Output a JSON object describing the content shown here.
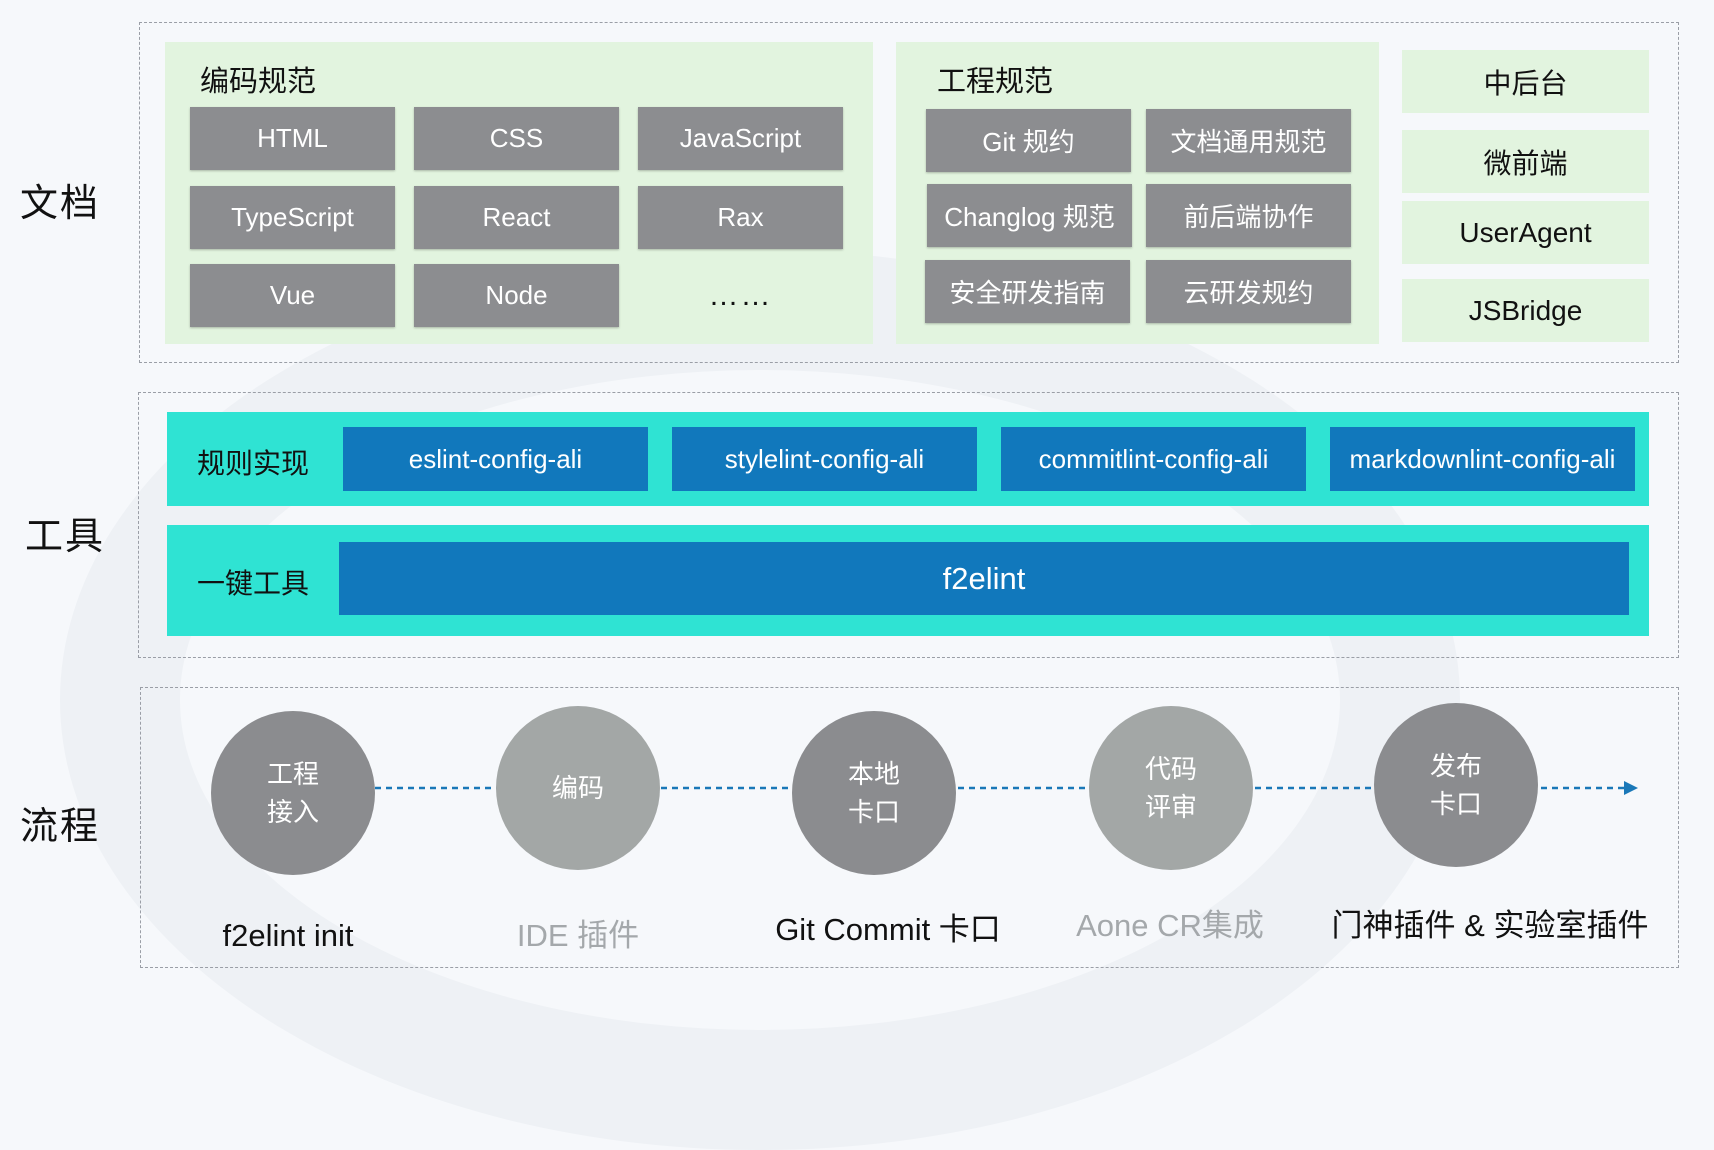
{
  "rows": {
    "docs": "文档",
    "tools": "工具",
    "process": "流程"
  },
  "coding_standards": {
    "title": "编码规范",
    "items": [
      "HTML",
      "CSS",
      "JavaScript",
      "TypeScript",
      "React",
      "Rax",
      "Vue",
      "Node"
    ],
    "more": "……"
  },
  "engineering_standards": {
    "title": "工程规范",
    "items": [
      "Git 规约",
      "文档通用规范",
      "Changlog 规范",
      "前后端协作",
      "安全研发指南",
      "云研发规约"
    ]
  },
  "extra_docs": [
    "中后台",
    "微前端",
    "UserAgent",
    "JSBridge"
  ],
  "tools": {
    "rules_label": "规则实现",
    "rules": [
      "eslint-config-ali",
      "stylelint-config-ali",
      "commitlint-config-ali",
      "markdownlint-config-ali"
    ],
    "onekey_label": "一键工具",
    "onekey_tool": "f2elint"
  },
  "process": {
    "steps": [
      {
        "line1": "工程",
        "line2": "接入",
        "label": "f2elint init"
      },
      {
        "line1": "编码",
        "line2": "",
        "label": "IDE 插件"
      },
      {
        "line1": "本地",
        "line2": "卡口",
        "label": "Git Commit 卡口"
      },
      {
        "line1": "代码",
        "line2": "评审",
        "label": "Aone CR集成"
      },
      {
        "line1": "发布",
        "line2": "卡口",
        "label": "门神插件 & 实验室插件"
      }
    ]
  },
  "colors": {
    "green_panel": "#e2f4df",
    "gray_box": "#8c8d90",
    "cyan_band": "#2fe3d3",
    "blue_box": "#1178bc",
    "connector": "#1a78b8"
  }
}
